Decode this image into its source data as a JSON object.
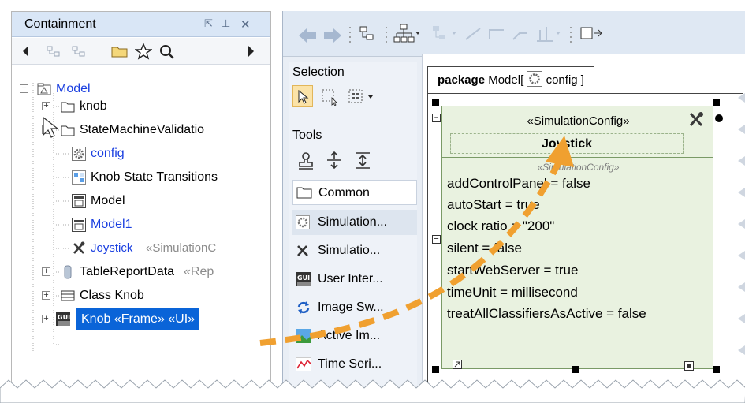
{
  "containment": {
    "title": "Containment",
    "tree": [
      {
        "label": "Model",
        "suffix": "",
        "icon": "model-icon"
      },
      {
        "label": "knob",
        "suffix": "",
        "icon": "folder-icon"
      },
      {
        "label": "StateMachineValidatio",
        "suffix": "",
        "icon": "folder-icon"
      },
      {
        "label": "config",
        "suffix": "",
        "icon": "gear-icon"
      },
      {
        "label": "Knob State Transitions",
        "suffix": "",
        "icon": "table-icon"
      },
      {
        "label": "Model",
        "suffix": "",
        "icon": "diagram-icon"
      },
      {
        "label": "Model1",
        "suffix": "",
        "icon": "diagram-icon"
      },
      {
        "label": "Joystick",
        "suffix": "«SimulationC",
        "icon": "tools-icon"
      },
      {
        "label": "TableReportData",
        "suffix": "«Rep",
        "icon": "cylinder-icon"
      },
      {
        "label": "Class Knob",
        "suffix": "",
        "icon": "class-icon"
      },
      {
        "label": "Knob «Frame» «UI»",
        "suffix": "",
        "icon": "gui-icon"
      }
    ]
  },
  "palette": {
    "selection_header": "Selection",
    "tools_header": "Tools",
    "items": [
      {
        "label": "Common",
        "icon": "folder-icon"
      },
      {
        "label": "Simulation...",
        "icon": "gear-icon"
      },
      {
        "label": "Simulatio...",
        "icon": "tools-icon"
      },
      {
        "label": "User Inter...",
        "icon": "gui-icon"
      },
      {
        "label": "Image Sw...",
        "icon": "refresh-icon"
      },
      {
        "label": "Active Im...",
        "icon": "image-icon"
      },
      {
        "label": "Time Seri...",
        "icon": "chart-icon"
      }
    ]
  },
  "diagram": {
    "tab_keyword": "package",
    "tab_name": "Model",
    "tab_open": "[",
    "tab_element": "config",
    "tab_close": "]",
    "block": {
      "stereotype": "«SimulationConfig»",
      "name": "Joystick",
      "compartment_stereotype": "«SimulationConfig»",
      "attributes": [
        "addControlPanel = false",
        "autoStart = true",
        "clock ratio = \"200\"",
        "silent = false",
        "startWebServer = true",
        "timeUnit = millisecond",
        "treatAllClassifiersAsActive = false"
      ]
    }
  },
  "colors": {
    "selection_highlight": "#0a64d8",
    "arrow": "#f0a030",
    "block_fill": "#e9f2e0",
    "link_blue": "#1a3fe0"
  }
}
